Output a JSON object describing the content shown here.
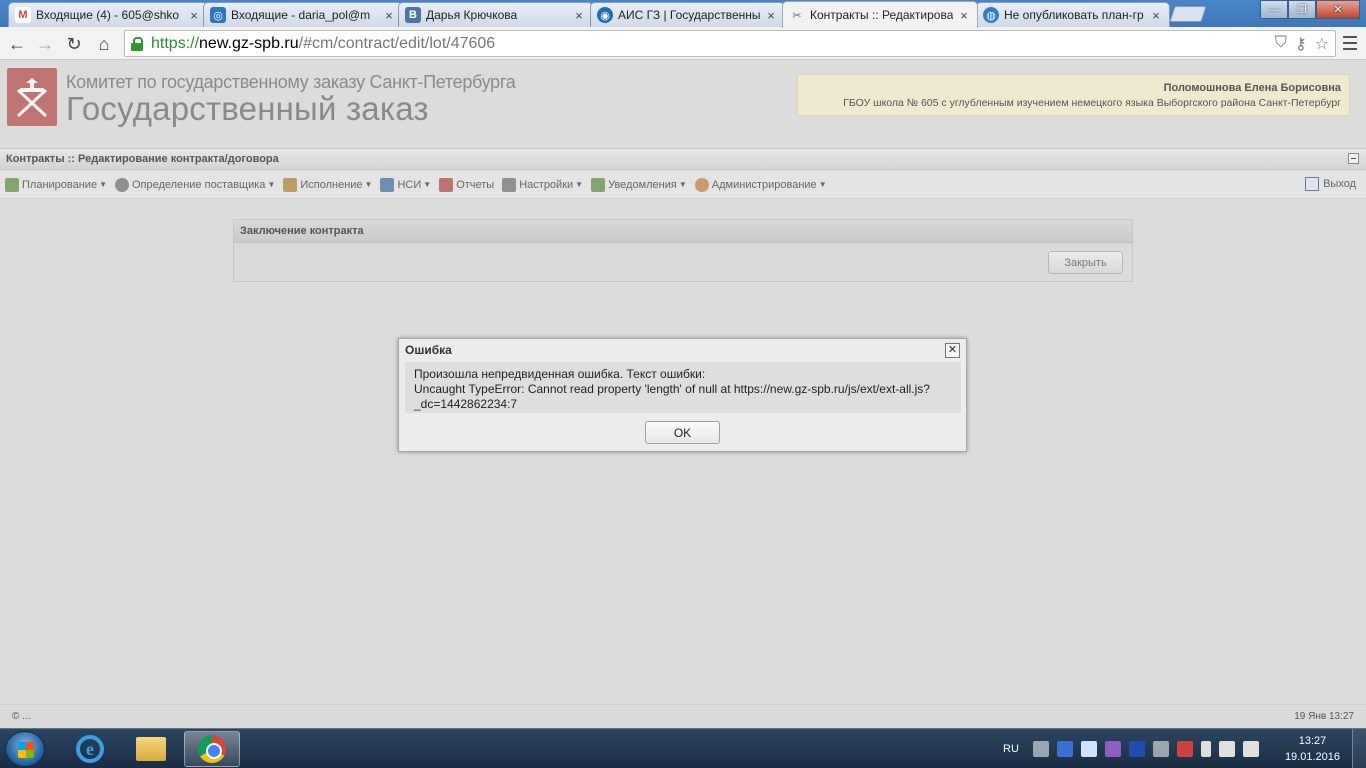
{
  "browser": {
    "tabs": [
      {
        "title": "Входящие (4) - 605@shko",
        "favicon": "gmail-icon",
        "color": "#d14836",
        "glyph": "M"
      },
      {
        "title": "Входящие - daria_pol@m",
        "favicon": "mail-icon",
        "color": "#2b78c2",
        "glyph": "◎"
      },
      {
        "title": "Дарья Крючкова",
        "favicon": "vk-icon",
        "color": "#4c75a3",
        "glyph": "В"
      },
      {
        "title": "АИС ГЗ | Государственны",
        "favicon": "eye-icon",
        "color": "#1b6db5",
        "glyph": "◉"
      },
      {
        "title": "Контракты :: Редактирова",
        "favicon": "tools-icon",
        "color": "#777777",
        "glyph": "✂"
      },
      {
        "title": "Не опубликовать план-гр",
        "favicon": "globe-icon",
        "color": "#2a7fd1",
        "glyph": "◍"
      }
    ],
    "url": {
      "scheme": "https://",
      "host": "new.gz-spb.ru",
      "path": "/#cm/contract/edit/lot/47606"
    }
  },
  "header": {
    "org_line1": "Комитет по государственному заказу Санкт-Петербурга",
    "org_line2": "Государственный заказ",
    "user_name": "Поломошнова Елена Борисовна",
    "user_org": "ГБОУ школа № 605 с углубленным изучением немецкого языка Выборгского района Санкт-Петербург"
  },
  "titlebar": {
    "title": "Контракты :: Редактирование контракта/договора"
  },
  "menu": {
    "items": [
      {
        "label": "Планирование",
        "icon": "planning-icon",
        "color": "#5a8a3c"
      },
      {
        "label": "Определение поставщика",
        "icon": "gears-icon",
        "color": "#6c6c6c"
      },
      {
        "label": "Исполнение",
        "icon": "execution-icon",
        "color": "#b07c2c"
      },
      {
        "label": "НСИ",
        "icon": "book-icon",
        "color": "#3a6aa0"
      },
      {
        "label": "Отчеты",
        "icon": "report-icon",
        "color": "#b04040"
      },
      {
        "label": "Настройки",
        "icon": "wrench-icon",
        "color": "#6c6c6c"
      },
      {
        "label": "Уведомления",
        "icon": "notification-icon",
        "color": "#5a8a3c"
      },
      {
        "label": "Администрирование",
        "icon": "user-icon",
        "color": "#c07a30"
      }
    ],
    "exit_label": "Выход"
  },
  "panel": {
    "title": "Заключение контракта",
    "close_label": "Закрыть"
  },
  "dialog": {
    "title": "Ошибка",
    "line1": "Произошла непредвиденная ошибка. Текст ошибки:",
    "line2": "Uncaught TypeError: Cannot read property 'length' of null at https://new.gz-spb.ru/js/ext/ext-all.js?",
    "line3": "_dc=1442862234:7",
    "ok_label": "OK"
  },
  "footer": {
    "left": "© ...",
    "right": "19 Янв 13:27"
  },
  "taskbar": {
    "lang": "RU",
    "time": "13:27",
    "date": "19.01.2016"
  }
}
